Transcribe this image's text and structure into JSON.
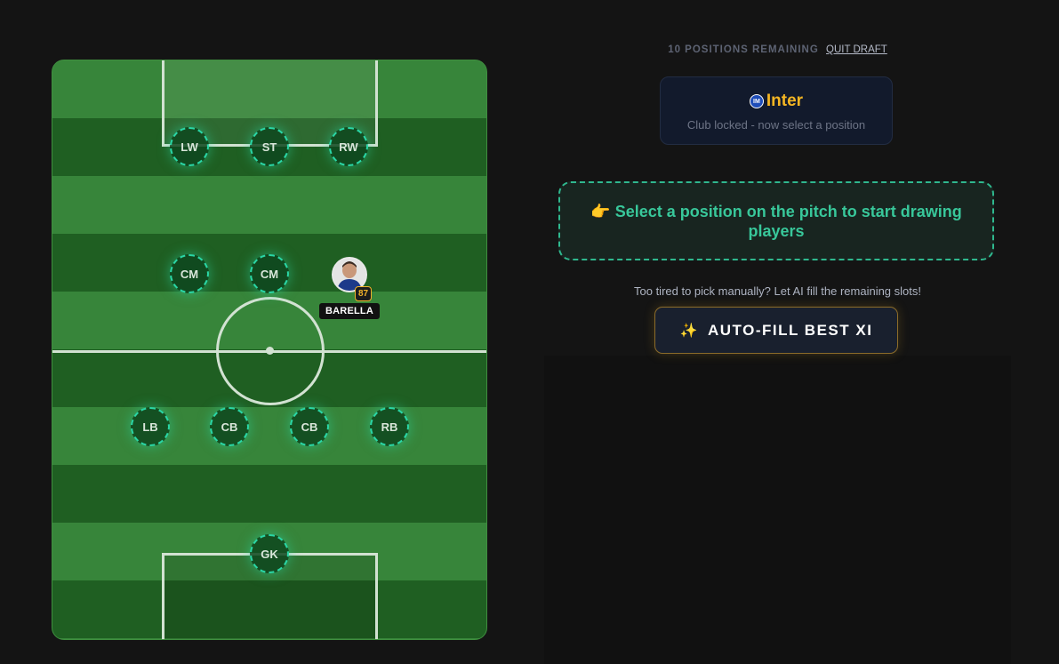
{
  "header": {
    "remaining": "10 POSITIONS REMAINING",
    "quit": "QUIT DRAFT"
  },
  "club": {
    "name": "Inter",
    "logo_text": "IM",
    "subtitle": "Club locked - now select a position"
  },
  "prompt": {
    "icon": "👉",
    "text": "Select a position on the pitch to start drawing players"
  },
  "autofill": {
    "hint": "Too tired to pick manually? Let AI fill the remaining slots!",
    "icon": "✨",
    "label": "AUTO-FILL BEST XI"
  },
  "pitch": {
    "slots": {
      "lw": "LW",
      "st": "ST",
      "rw": "RW",
      "cm1": "CM",
      "cm2": "CM",
      "lb": "LB",
      "cb1": "CB",
      "cb2": "CB",
      "rb": "RB",
      "gk": "GK"
    },
    "player": {
      "name": "BARELLA",
      "rating": "87"
    }
  },
  "colors": {
    "accent": "#2ad6a6",
    "gold": "#f5b623",
    "pitch_light": "#37853a",
    "pitch_dark": "#1f5f22"
  }
}
